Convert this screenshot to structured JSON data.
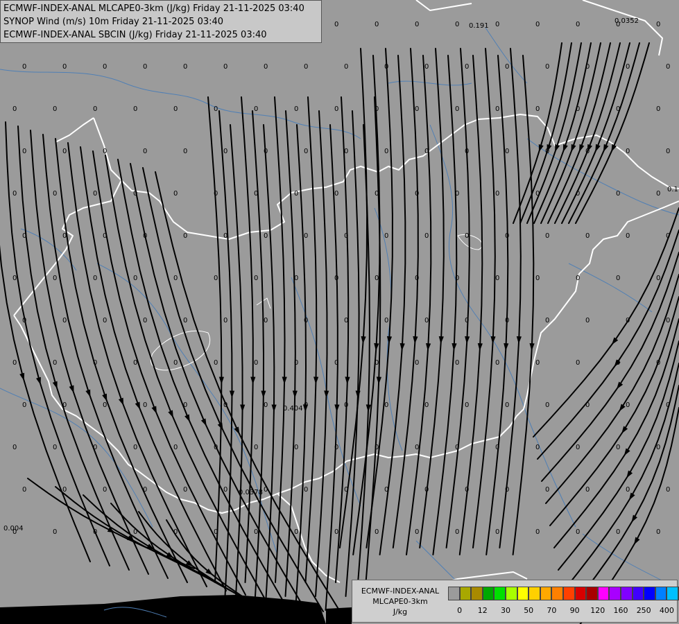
{
  "titles": [
    "ECMWF-INDEX-ANAL MLCAPE0-3km (J/kg) Friday 21-11-2025 03:40",
    "SYNOP Wind (m/s) 10m Friday 21-11-2025 03:40",
    "ECMWF-INDEX-ANAL SBCIN (J/kg) Friday 21-11-2025 03:40"
  ],
  "colors": {
    "background": "#9b9b9b",
    "border": "#ffffff",
    "river": "#4f7fb5",
    "streamline": "#000000",
    "sea": "#000000"
  },
  "legend": {
    "title_line1": "ECMWF-INDEX-ANAL",
    "title_line2": "MLCAPE0-3km",
    "unit": "J/kg",
    "swatches": [
      "#9b9b9b",
      "#a8a800",
      "#a88a00",
      "#00a800",
      "#00e000",
      "#a8ff00",
      "#ffff00",
      "#ffd000",
      "#ffa800",
      "#ff8000",
      "#ff4000",
      "#d80000",
      "#a80000",
      "#ff00ff",
      "#a800ff",
      "#8000ff",
      "#4000ff",
      "#0000ff",
      "#0080ff",
      "#00c0ff",
      "#00ffff",
      "#80ffff",
      "#ffffff"
    ],
    "ticks": [
      {
        "label": "0",
        "index": 1
      },
      {
        "label": "12",
        "index": 3
      },
      {
        "label": "30",
        "index": 5
      },
      {
        "label": "50",
        "index": 7
      },
      {
        "label": "70",
        "index": 9
      },
      {
        "label": "90",
        "index": 11
      },
      {
        "label": "120",
        "index": 13
      },
      {
        "label": "160",
        "index": 15
      },
      {
        "label": "250",
        "index": 17
      },
      {
        "label": "400",
        "index": 19
      }
    ]
  },
  "special_values": [
    "0.191",
    "0.0352",
    "0.404",
    "0.0378",
    "0.004",
    "0.1"
  ]
}
